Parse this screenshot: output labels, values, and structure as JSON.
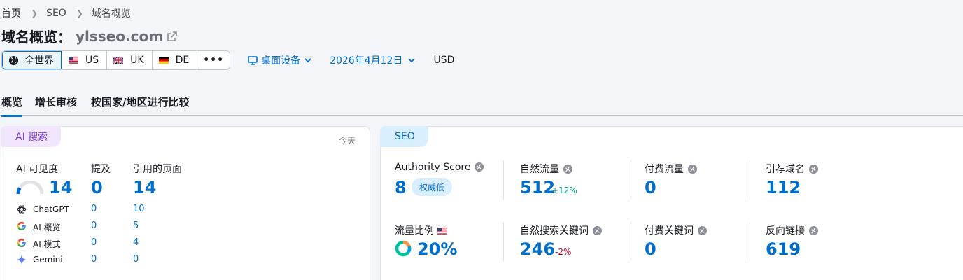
{
  "breadcrumb": {
    "home": "首页",
    "seo": "SEO",
    "current": "域名概览"
  },
  "header": {
    "title": "域名概览：",
    "domain": "ylsseo.com"
  },
  "filters": {
    "regions": [
      {
        "label": "全世界",
        "icon": "globe-icon"
      },
      {
        "label": "US",
        "icon": "us-flag-icon"
      },
      {
        "label": "UK",
        "icon": "uk-flag-icon"
      },
      {
        "label": "DE",
        "icon": "de-flag-icon"
      }
    ],
    "more": "•••",
    "device": "桌面设备",
    "date": "2026年4月12日",
    "currency": "USD"
  },
  "tabs": [
    "概览",
    "增长审核",
    "按国家/地区进行比较"
  ],
  "ai_card": {
    "pill": "AI 搜索",
    "today": "今天",
    "visibility_label": "AI 可见度",
    "visibility_value": "14",
    "visibility_gauge": 0.14,
    "mentions_label": "提及",
    "mentions_value": "0",
    "cited_label": "引用的页面",
    "cited_value": "14",
    "rows": [
      {
        "name": "ChatGPT",
        "icon": "chatgpt-icon",
        "mentions": "0",
        "cited": "10"
      },
      {
        "name": "AI 概览",
        "icon": "google-icon",
        "mentions": "0",
        "cited": "5"
      },
      {
        "name": "AI 模式",
        "icon": "google-icon",
        "mentions": "0",
        "cited": "4"
      },
      {
        "name": "Gemini",
        "icon": "gemini-icon",
        "mentions": "0",
        "cited": "0"
      }
    ]
  },
  "seo_card": {
    "pill": "SEO",
    "authority": {
      "label": "Authority Score",
      "value": "8",
      "badge": "权威低"
    },
    "organic_traffic": {
      "label": "自然流量",
      "value": "512",
      "delta": "+12%"
    },
    "paid_traffic": {
      "label": "付费流量",
      "value": "0"
    },
    "ref_domains": {
      "label": "引荐域名",
      "value": "112"
    },
    "traffic_share": {
      "label": "流量比例",
      "value": "20%"
    },
    "organic_keywords": {
      "label": "自然搜索关键词",
      "value": "246",
      "delta": "-2%"
    },
    "paid_keywords": {
      "label": "付费关键词",
      "value": "0"
    },
    "backlinks": {
      "label": "反向链接",
      "value": "619"
    }
  },
  "colors": {
    "accent": "#006dca",
    "ai_purple": "#7f3fd8",
    "positive": "#009f81",
    "negative": "#d1002f"
  }
}
